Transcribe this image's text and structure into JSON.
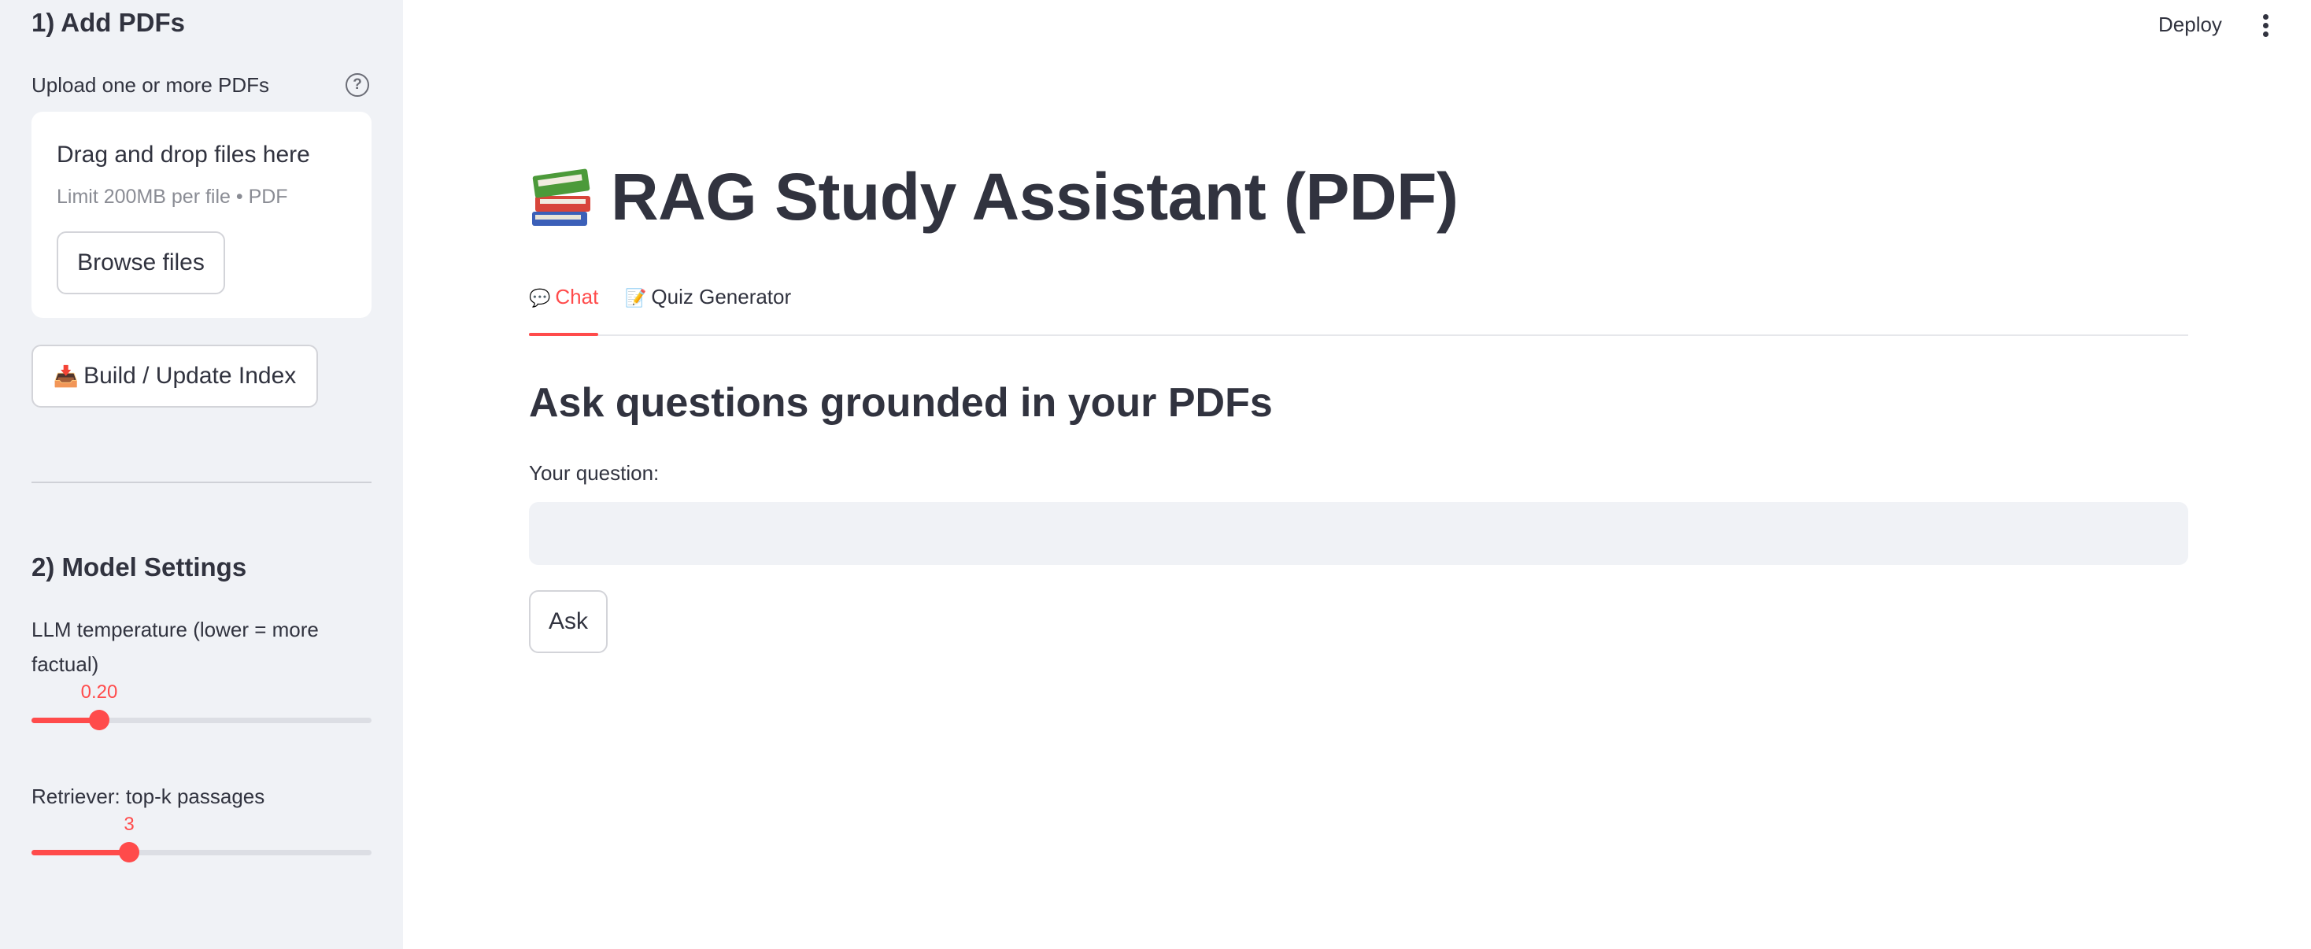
{
  "header": {
    "deploy_label": "Deploy",
    "menu_icon": "kebab-vertical-icon"
  },
  "sidebar": {
    "section1_title": "1) Add PDFs",
    "upload_label": "Upload one or more PDFs",
    "help_icon": "question-circle-icon",
    "help_glyph": "?",
    "dropzone": {
      "title": "Drag and drop files here",
      "limit_text": "Limit 200MB per file • PDF",
      "browse_label": "Browse files"
    },
    "build_button": {
      "emoji": "📥",
      "label": "Build / Update Index"
    },
    "section2_title": "2) Model Settings",
    "temperature": {
      "label": "LLM temperature (lower = more factual)",
      "value_text": "0.20",
      "fraction": 0.2
    },
    "topk": {
      "label": "Retriever: top-k passages",
      "value_text": "3",
      "fraction": 0.286
    }
  },
  "main": {
    "title_icon": "books-icon",
    "title": "RAG Study Assistant (PDF)",
    "tabs": [
      {
        "emoji": "💬",
        "label": "Chat",
        "active": true
      },
      {
        "emoji": "📝",
        "label": "Quiz Generator",
        "active": false
      }
    ],
    "section_title": "Ask questions grounded in your PDFs",
    "question_label": "Your question:",
    "question_value": "",
    "ask_label": "Ask"
  },
  "colors": {
    "accent": "#ff4b4b",
    "sidebar_bg": "#f0f2f6",
    "text": "#31333f"
  }
}
